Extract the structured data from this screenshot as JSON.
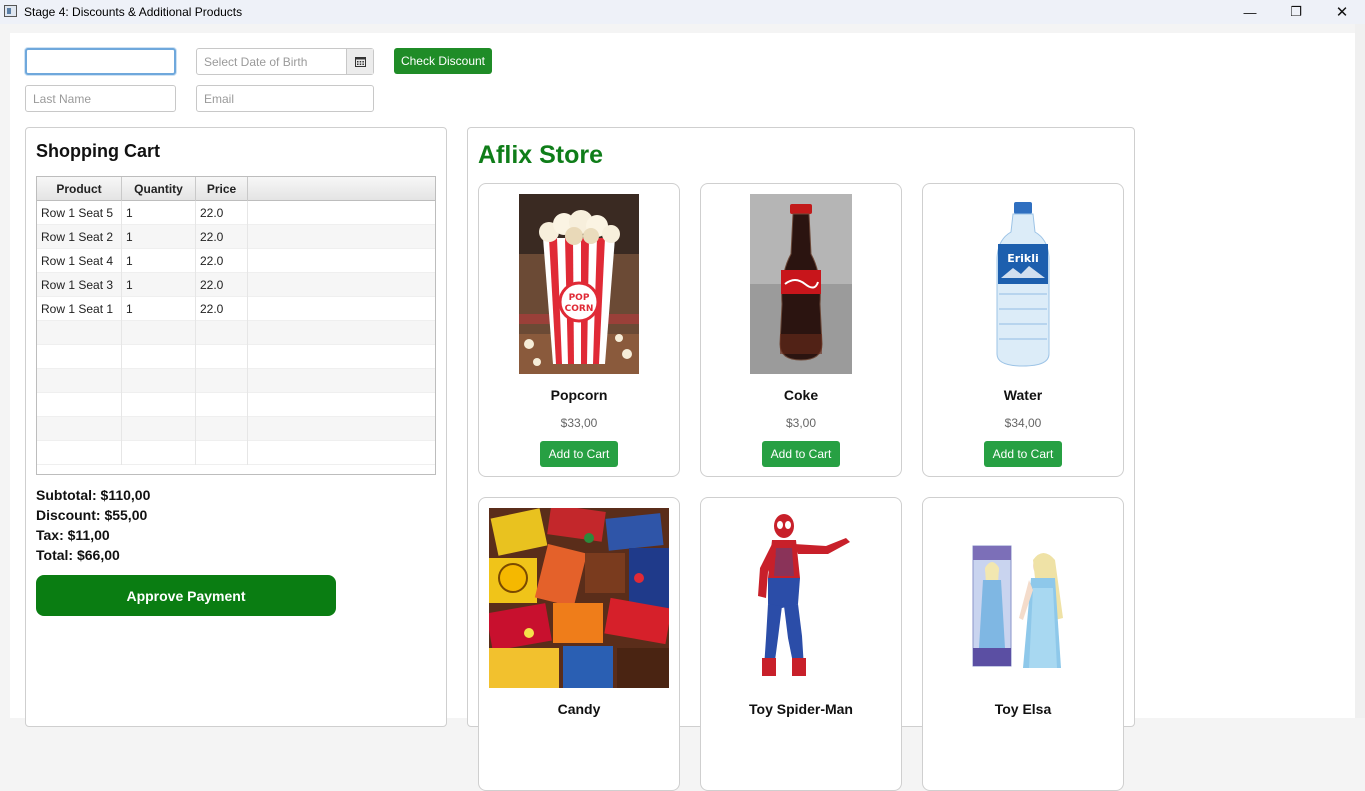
{
  "window": {
    "title": "Stage 4: Discounts & Additional Products",
    "minimize_glyph": "—",
    "maximize_glyph": "❐",
    "close_glyph": "✕"
  },
  "form": {
    "first_name_value": "",
    "dob_placeholder": "Select Date of Birth",
    "check_discount_label": "Check Discount",
    "last_name_placeholder": "Last Name",
    "email_placeholder": "Email"
  },
  "cart": {
    "title": "Shopping Cart",
    "columns": [
      "Product",
      "Quantity",
      "Price"
    ],
    "rows": [
      {
        "product": "Row 1 Seat 5",
        "quantity": "1",
        "price": "22.0"
      },
      {
        "product": "Row 1 Seat 2",
        "quantity": "1",
        "price": "22.0"
      },
      {
        "product": "Row 1 Seat 4",
        "quantity": "1",
        "price": "22.0"
      },
      {
        "product": "Row 1 Seat 3",
        "quantity": "1",
        "price": "22.0"
      },
      {
        "product": "Row 1 Seat 1",
        "quantity": "1",
        "price": "22.0"
      }
    ],
    "subtotal": "Subtotal: $110,00",
    "discount": "Discount: $55,00",
    "tax": "Tax: $11,00",
    "total": "Total: $66,00",
    "approve_label": "Approve Payment"
  },
  "store": {
    "title": "Aflix Store",
    "products": [
      {
        "name": "Popcorn",
        "price": "$33,00",
        "button": "Add to Cart",
        "icon": "popcorn-image"
      },
      {
        "name": "Coke",
        "price": "$3,00",
        "button": "Add to Cart",
        "icon": "coke-image"
      },
      {
        "name": "Water",
        "price": "$34,00",
        "button": "Add to Cart",
        "icon": "water-image"
      },
      {
        "name": "Candy",
        "price": "",
        "button": "",
        "icon": "candy-image"
      },
      {
        "name": "Toy Spider-Man",
        "price": "",
        "button": "",
        "icon": "spiderman-image"
      },
      {
        "name": "Toy Elsa",
        "price": "",
        "button": "",
        "icon": "elsa-image"
      }
    ],
    "popcorn_box_text": [
      "POP",
      "CORN"
    ],
    "water_label_text": "Erikli"
  },
  "colors": {
    "store_title": "#0f7d19",
    "approve_button": "#0a7d12",
    "add_to_cart": "#27a043",
    "check_discount": "#1f8c27"
  }
}
